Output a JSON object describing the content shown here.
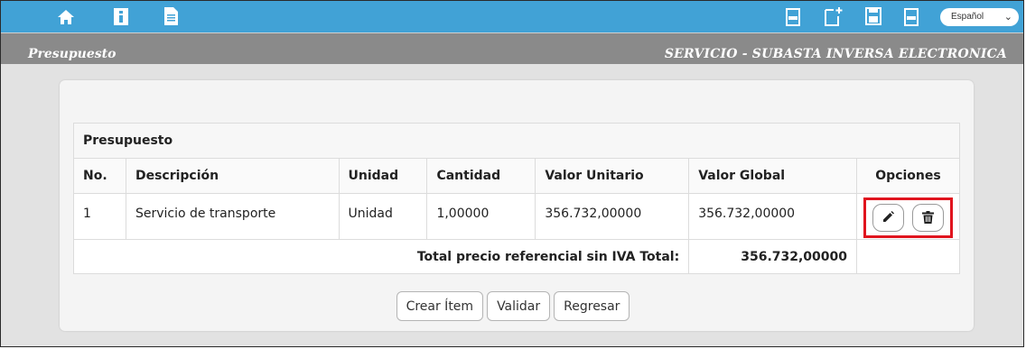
{
  "topbar": {
    "color": "#41a2d6",
    "left_icons": [
      "home-icon",
      "info-icon",
      "document-icon"
    ],
    "right_icons": [
      "pdf-icon",
      "new-document-icon",
      "save-icon",
      "pdf-icon"
    ],
    "language": "Español"
  },
  "subbar": {
    "left_title": "Presupuesto",
    "right_title": "SERVICIO - SUBASTA INVERSA ELECTRONICA"
  },
  "table": {
    "title": "Presupuesto",
    "headers": [
      "No.",
      "Descripción",
      "Unidad",
      "Cantidad",
      "Valor Unitario",
      "Valor Global",
      "Opciones"
    ],
    "rows": [
      {
        "no": "1",
        "descripcion": "Servicio de transporte",
        "unidad": "Unidad",
        "cantidad": "1,00000",
        "valor_unitario": "356.732,00000",
        "valor_global": "356.732,00000",
        "options": [
          "edit-icon",
          "delete-icon"
        ]
      }
    ],
    "total_label": "Total precio referencial sin IVA Total:",
    "total_value": "356.732,00000"
  },
  "actions": {
    "create": "Crear Ítem",
    "validate": "Validar",
    "back": "Regresar"
  },
  "highlight_color": "#e0141e"
}
